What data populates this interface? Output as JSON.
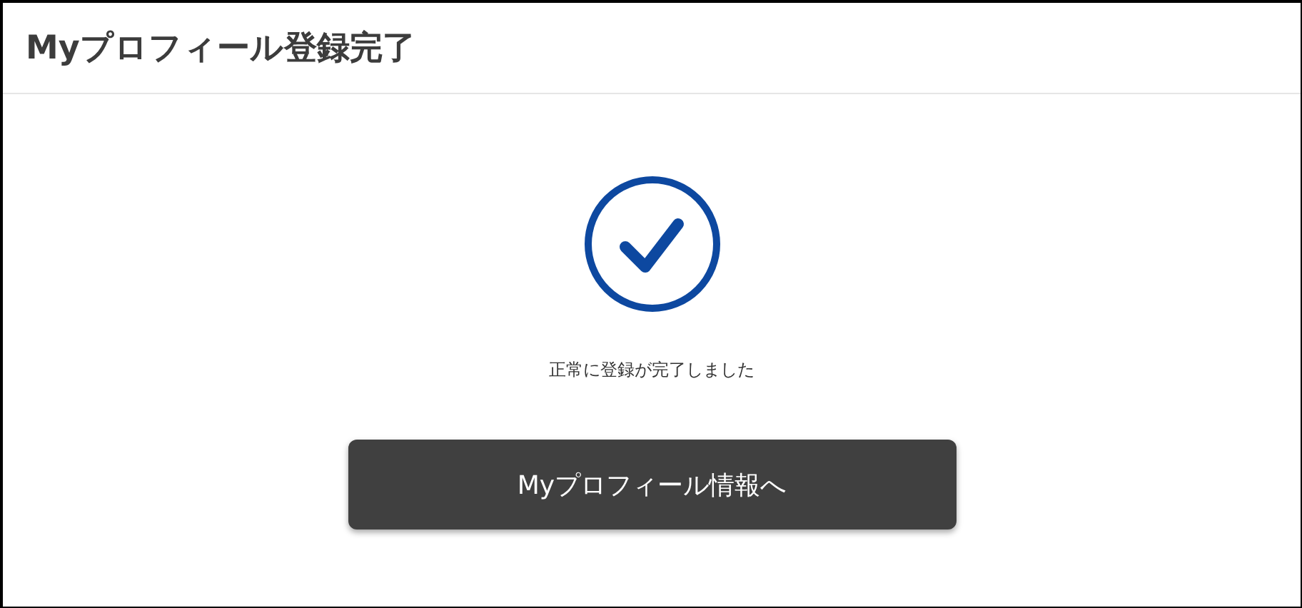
{
  "title": "Myプロフィール登録完了",
  "message": "正常に登録が完了しました",
  "button": {
    "label": "Myプロフィール情報へ"
  }
}
